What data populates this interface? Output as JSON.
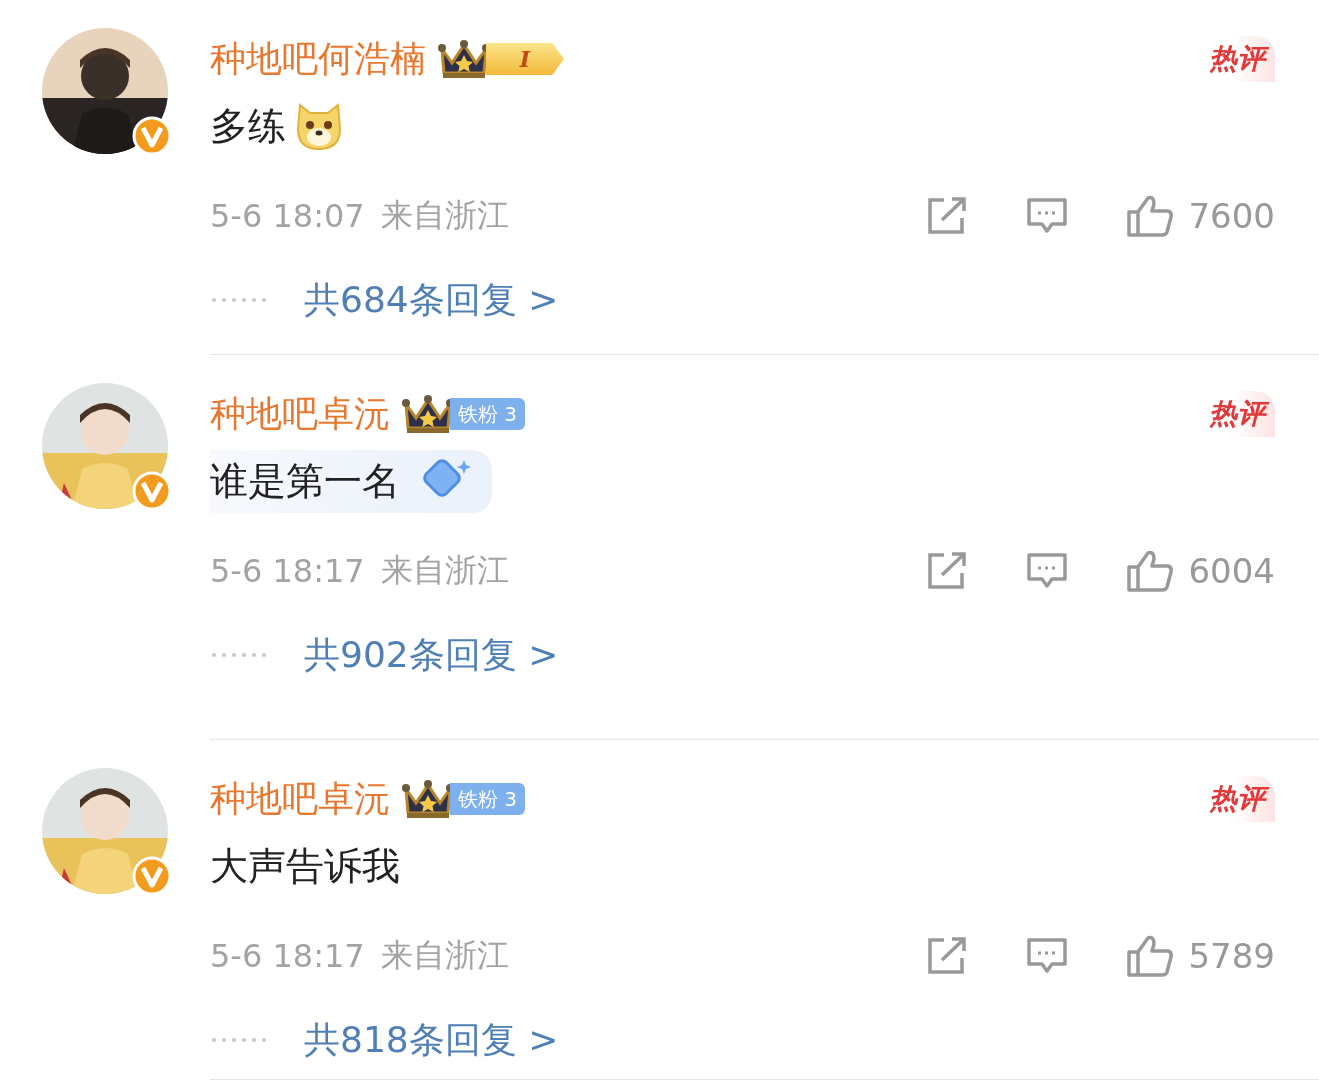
{
  "comments": [
    {
      "name": "种地吧何浩楠",
      "badge": {
        "kind": "crown",
        "text": "I"
      },
      "hot_tag": "热评",
      "text": "多练",
      "emoji": true,
      "time": "5-6 18:07",
      "location": "来自浙江",
      "likes": "7600",
      "replies": "共684条回复 >"
    },
    {
      "name": "种地吧卓沅",
      "badge": {
        "kind": "iron",
        "text": "铁粉 3"
      },
      "hot_tag": "热评",
      "text": "谁是第一名",
      "bubble": true,
      "time": "5-6 18:17",
      "location": "来自浙江",
      "likes": "6004",
      "replies": "共902条回复 >"
    },
    {
      "name": "种地吧卓沅",
      "badge": {
        "kind": "iron",
        "text": "铁粉 3"
      },
      "hot_tag": "热评",
      "text": "大声告诉我",
      "time": "5-6 18:17",
      "location": "来自浙江",
      "likes": "5789",
      "replies": "共818条回复 >"
    }
  ]
}
